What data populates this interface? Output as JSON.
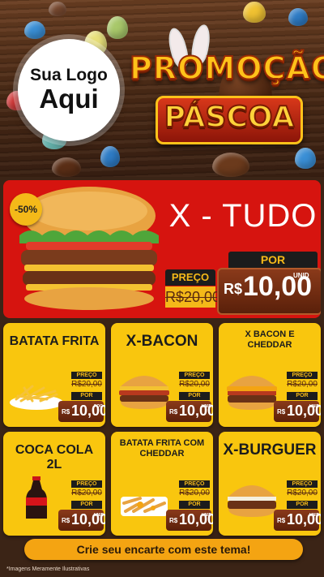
{
  "header": {
    "logo_line1": "Sua Logo",
    "logo_line2": "Aqui",
    "title_line1": "PROMOÇÃO",
    "title_line2": "PÁSCOA"
  },
  "hero": {
    "discount": "-50%",
    "name": "X - TUDO",
    "preco_label": "PREÇO",
    "old_price": "R$20,00",
    "por_label": "POR",
    "currency": "R$",
    "price": "10,00",
    "unit": "UNID"
  },
  "products": [
    {
      "name": "BATATA FRITA",
      "preco_label": "PREÇO",
      "old_price": "R$20,00",
      "por_label": "POR",
      "currency": "R$",
      "price": "10,00",
      "unit": "POÇ",
      "icon": "fries-icon"
    },
    {
      "name": "X-BACON",
      "preco_label": "PREÇO",
      "old_price": "R$20,00",
      "por_label": "POR",
      "currency": "R$",
      "price": "10,00",
      "unit": "UNID",
      "icon": "bacon-burger-icon"
    },
    {
      "name": "X BACON E CHEDDAR",
      "preco_label": "PREÇO",
      "old_price": "R$20,00",
      "por_label": "POR",
      "currency": "R$",
      "price": "10,00",
      "unit": "UNID",
      "icon": "cheddar-burger-icon"
    },
    {
      "name": "COCA COLA 2L",
      "preco_label": "PREÇO",
      "old_price": "R$20,00",
      "por_label": "POR",
      "currency": "R$",
      "price": "10,00",
      "unit": "UNID",
      "icon": "soda-bottle-icon"
    },
    {
      "name": "BATATA FRITA COM CHEDDAR",
      "preco_label": "PREÇO",
      "old_price": "R$20,00",
      "por_label": "POR",
      "currency": "R$",
      "price": "10,00",
      "unit": "UNID",
      "icon": "cheddar-fries-icon"
    },
    {
      "name": "X-BURGUER",
      "preco_label": "PREÇO",
      "old_price": "R$20,00",
      "por_label": "POR",
      "currency": "R$",
      "price": "10,00",
      "unit": "UNID",
      "icon": "burger-icon"
    }
  ],
  "cta": "Crie seu encarte com este tema!",
  "disclaimer": "*Imagens Meramente Ilustrativas",
  "colors": {
    "hero_red": "#d6140f",
    "card_yellow": "#f9c60e",
    "price_brown": "#6e2a10",
    "cta_orange": "#f4a412"
  }
}
